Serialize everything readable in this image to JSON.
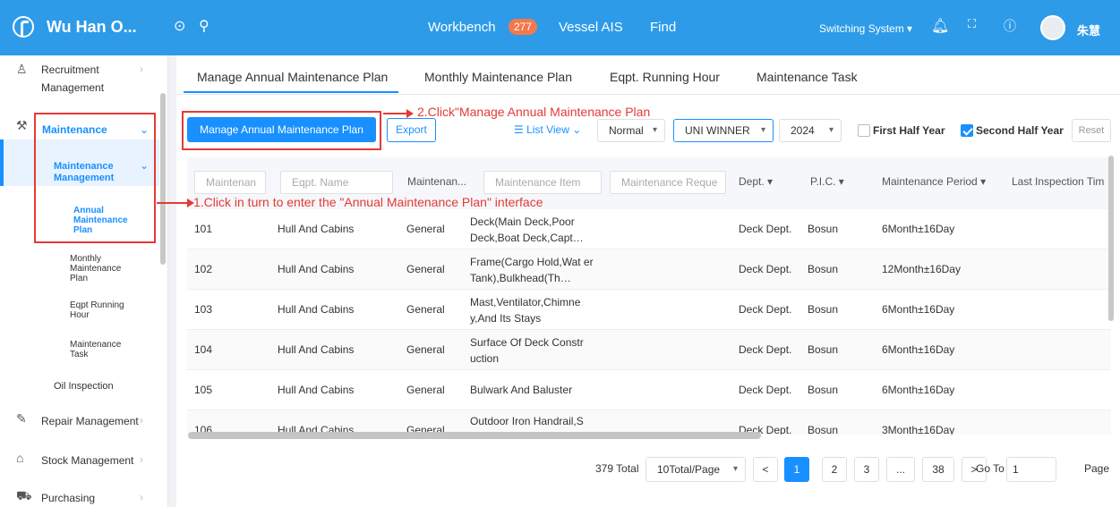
{
  "topbar": {
    "app_title": "Wu Han O...",
    "nav": {
      "workbench": "Workbench",
      "workbench_badge": "277",
      "vessel_ais": "Vessel AIS",
      "find": "Find"
    },
    "switching": "Switching System ▾",
    "user": "朱慧"
  },
  "sidebar": {
    "recruitment": "Recruitment Management",
    "maintenance": "Maintenance",
    "maintenance_mgmt": "Maintenance Management",
    "annual": "Annual Maintenance Plan",
    "monthly": "Monthly Maintenance Plan",
    "eqpt": "Eqpt Running Hour",
    "task": "Maintenance Task",
    "oil": "Oil Inspection",
    "repair": "Repair Management",
    "stock": "Stock Management",
    "purchasing": "Purchasing"
  },
  "tabs": [
    "Manage Annual Maintenance Plan",
    "Monthly Maintenance Plan",
    "Eqpt. Running Hour",
    "Maintenance Task"
  ],
  "toolbar": {
    "manage_btn": "Manage Annual Maintenance Plan",
    "export_btn": "Export",
    "list_view": "List View",
    "mode": "Normal",
    "vessel": "UNI WINNER",
    "year": "2024",
    "first_half": "First Half Year",
    "second_half": "Second Half Year",
    "reset": "Reset"
  },
  "annotations": {
    "step2": "2.Click\"Manage Annual Maintenance Plan",
    "step1": "1.Click in turn to enter the \"Annual Maintenance Plan\" interface"
  },
  "table": {
    "filters": {
      "no": "Maintenan",
      "eqpt": "Eqpt. Name",
      "item": "Maintenance Item",
      "req": "Maintenance Reque"
    },
    "headers": {
      "type": "Maintenan...",
      "dept": "Dept. ▾",
      "pic": "P.I.C. ▾",
      "period": "Maintenance Period ▾",
      "last": "Last Inspection Tim"
    },
    "rows": [
      {
        "no": "101",
        "eqpt": "Hull And Cabins",
        "type": "General",
        "item": "Deck(Main Deck,Poor Deck,Boat Deck,Capt…",
        "dept": "Deck Dept.",
        "pic": "Bosun",
        "period": "6Month±16Day"
      },
      {
        "no": "102",
        "eqpt": "Hull And Cabins",
        "type": "General",
        "item": "Frame(Cargo Hold,Wat er Tank),Bulkhead(Th…",
        "dept": "Deck Dept.",
        "pic": "Bosun",
        "period": "12Month±16Day"
      },
      {
        "no": "103",
        "eqpt": "Hull And Cabins",
        "type": "General",
        "item": "Mast,Ventilator,Chimne y,And Its Stays",
        "dept": "Deck Dept.",
        "pic": "Bosun",
        "period": "6Month±16Day"
      },
      {
        "no": "104",
        "eqpt": "Hull And Cabins",
        "type": "General",
        "item": "Surface Of Deck Constr uction",
        "dept": "Deck Dept.",
        "pic": "Bosun",
        "period": "6Month±16Day"
      },
      {
        "no": "105",
        "eqpt": "Hull And Cabins",
        "type": "General",
        "item": "Bulwark And Baluster",
        "dept": "Deck Dept.",
        "pic": "Bosun",
        "period": "6Month±16Day"
      },
      {
        "no": "106",
        "eqpt": "Hull And Cabins",
        "type": "General",
        "item": "Outdoor Iron Handrail,S",
        "dept": "Deck Dept.",
        "pic": "Bosun",
        "period": "3Month±16Day"
      }
    ]
  },
  "pagination": {
    "total": "379 Total",
    "size": "10Total/Page",
    "prev": "<",
    "next": ">",
    "pages": [
      "1",
      "2",
      "3",
      "...",
      "38"
    ],
    "goto_label": "Go To",
    "goto_value": "1",
    "page_label": "Page"
  }
}
